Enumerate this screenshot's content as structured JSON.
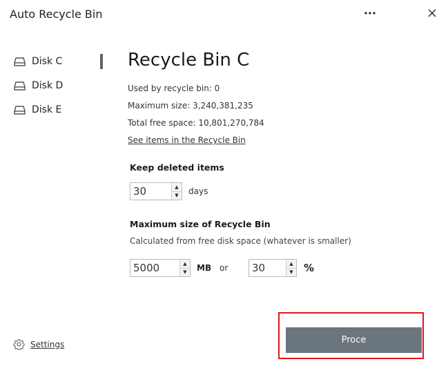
{
  "window": {
    "title": "Auto Recycle Bin"
  },
  "sidebar": {
    "items": [
      {
        "label": "Disk C"
      },
      {
        "label": "Disk D"
      },
      {
        "label": "Disk E"
      }
    ],
    "settings_label": "Settings"
  },
  "main": {
    "title": "Recycle Bin C",
    "used_text": "Used by recycle bin: 0",
    "max_size_text": "Maximum size: 3,240,381,235",
    "free_space_text": "Total free space: 10,801,270,784",
    "see_items_link": "See items in the Recycle Bin",
    "keep_section": {
      "title": "Keep deleted items",
      "value": "30",
      "unit": "days"
    },
    "max_section": {
      "title": "Maximum size of Recycle Bin",
      "subtitle": "Calculated from free disk space (whatever is smaller)",
      "mb_value": "5000",
      "mb_unit": "MB",
      "or_label": "or",
      "pct_value": "30",
      "pct_unit": "%"
    },
    "proceed_label": "Proce"
  },
  "colors": {
    "button_bg": "#6b757d",
    "highlight": "#e0141b",
    "active_indicator": "#5a6470"
  }
}
